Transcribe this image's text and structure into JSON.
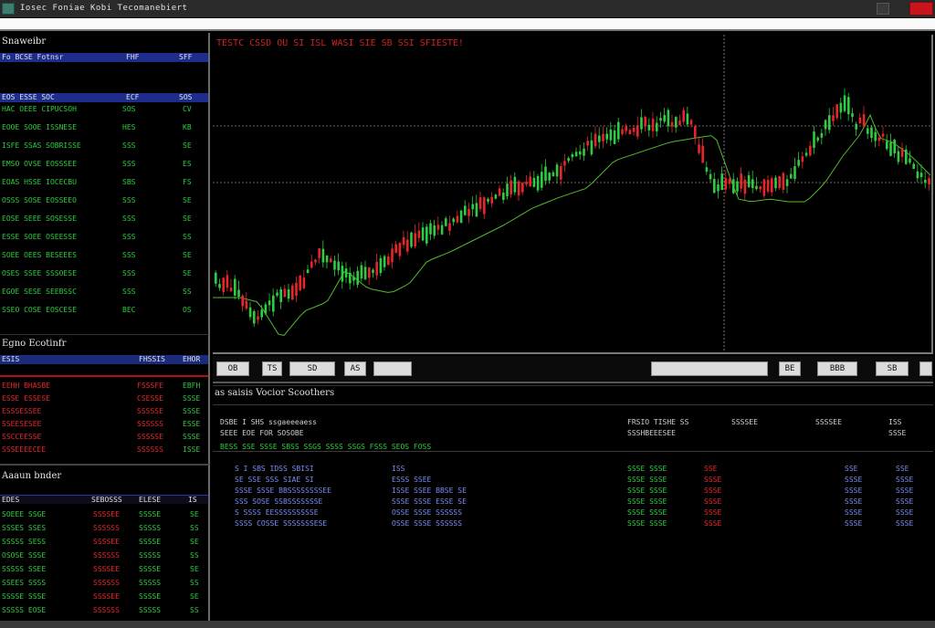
{
  "window": {
    "title": "Iosec  Foniae  Kobi  Tecomanebiert",
    "minimize": "",
    "close": ""
  },
  "watchlist": {
    "title": "Snaweibr",
    "header": [
      "Fo  BCSE  Fotnsr",
      "FHF",
      "SFF"
    ],
    "subheader": [
      "EOS  ESSE  SOC",
      "ECF",
      "SOS"
    ],
    "rows": [
      [
        "HAC  OEEE  CIPUCSOH",
        "SOS",
        "CV"
      ],
      [
        "EOOE  SOOE  ISSNESE",
        "HES",
        "KB"
      ],
      [
        "ISFE  SSAS  SOBRISSE",
        "SSS",
        "SE"
      ],
      [
        "EMSO  OVSE  EOSSSEE",
        "SSS",
        "ES"
      ],
      [
        "EOAS  HSSE  IOCECBU",
        "SBS",
        "FS"
      ],
      [
        "OSSS  SOSE  EOSSEEO",
        "SSS",
        "SE"
      ],
      [
        "EOSE  SEEE  SOSESSE",
        "SSS",
        "SE"
      ],
      [
        "ESSE  SOEE  OSEESSE",
        "SSS",
        "SS"
      ],
      [
        "SOEE  OEES  BESEEES",
        "SSS",
        "SE"
      ],
      [
        "OSES  SSEE  SSSOESE",
        "SSS",
        "SE"
      ],
      [
        "EGOE  SESE  SEEBSSC",
        "SSS",
        "SS"
      ],
      [
        "SSEO  COSE  EOSCESE",
        "BEC",
        "OS"
      ]
    ]
  },
  "depth": {
    "title": "Egno Ecotinfr",
    "header": [
      "ESIS",
      "FHSSIS",
      "EHOR"
    ],
    "rows": [
      [
        "EEHH  BHASBE",
        "FSSSFE",
        "EBFH"
      ],
      [
        "ESSE  ESSESE",
        "CSESSE",
        "SSSE"
      ],
      [
        "ESSSESSEE",
        "SSSSSE",
        "SSSE"
      ],
      [
        "SSEESESEE",
        "SSSSSS",
        "ESSE"
      ],
      [
        "SSCCEESSE",
        "SSSSSE",
        "SSSE"
      ],
      [
        "SSSEEEECEE",
        "SSSSSS",
        "ISSE"
      ]
    ]
  },
  "trades": {
    "title": "Aaaun bnder",
    "header": [
      "EDES",
      "SEBOSSS",
      "ELESE",
      "IS"
    ],
    "rows": [
      [
        "SOEEE  SSGE",
        "SSSSEE",
        "SSSSE",
        "SE"
      ],
      [
        "SSSES  SSES",
        "SSSSSS",
        "SSSSS",
        "SS"
      ],
      [
        "SSSSS  SESS",
        "SSSSEE",
        "SSSSE",
        "SE"
      ],
      [
        "OSOSE  SSSE",
        "SSSSSS",
        "SSSSS",
        "SS"
      ],
      [
        "SSSSS  SSEE",
        "SSSSEE",
        "SSSSE",
        "SE"
      ],
      [
        "SSEES  SSSS",
        "SSSSSS",
        "SSSSS",
        "SS"
      ],
      [
        "SSSSE  SSSE",
        "SSSSEE",
        "SSSSE",
        "SE"
      ],
      [
        "SSSSS  EOSE",
        "SSSSSS",
        "SSSSS",
        "SS"
      ]
    ]
  },
  "chart": {
    "title": "TESTC  CSSD  OU  SI  ISL    WASI  SIE  SB  SSI  SFIESTE!"
  },
  "toolbar": {
    "buttons": [
      "OB",
      "TS",
      "SD",
      "AS",
      "",
      "",
      "BE",
      "BBB",
      "SB",
      ""
    ]
  },
  "orders": {
    "title": "as  saisis  Vocior  Scoothers",
    "header_left": [
      "DSBE  I  SHS  ssgaeeeaess",
      "SEEE  EOE  FOR    SOSOBE"
    ],
    "header_mid": [
      "FRSIO  TISHE  SS",
      "SSSHBEEESEE"
    ],
    "header_right": [
      "SSSSEE",
      "SSSSEE",
      "ISS",
      "SSSE"
    ],
    "columns": [
      "BESS  SSE  SSSE  SBSS  SSGS  SSSS  SSGS  FSSS  SEOS  FOSS"
    ],
    "left_rows": [
      "S  I  SBS  IDSS  SBISI",
      "SE  SSE  SSS  SIAE  SI",
      "SSSE  SSSE  BBSSSSSSSSEE",
      "SSS  SOSE  SSBSSSSSSSE",
      "S  SSSS  EESSSSSSSSSE",
      "SSSS  COSSE  SSSSSSSESE"
    ],
    "mid_rows": [
      "ISS",
      "ESSS  SSEE",
      "ISSE  SSEE  BBSE  SE",
      "SSSE  SSSE  ESSE  SE",
      "OSSE  SSSE  SSSSSS",
      "OSSE  SSSE  SSSSSS"
    ],
    "qty_rows": [
      "SSSE  SSSE",
      "SSSE  SSSE",
      "SSSE  SSSE",
      "SSSE  SSSE",
      "SSSE  SSSE",
      "SSSE  SSSE"
    ],
    "price_rows": [
      "SSE",
      "SSSE",
      "SSSE",
      "SSSE",
      "SSSE",
      "SSSE"
    ],
    "right_a": [
      "SSE",
      "SSSE",
      "SSSE",
      "SSSE",
      "SSSE",
      "SSSE"
    ],
    "right_b": [
      "SSE",
      "SSSE",
      "SSSE",
      "SSSE",
      "SSSE",
      "SSSE"
    ]
  },
  "colors": {
    "up": "#2ecc40",
    "down": "#e8262a",
    "ma": "#55b82a",
    "header_blue": "#1e2d8c"
  }
}
